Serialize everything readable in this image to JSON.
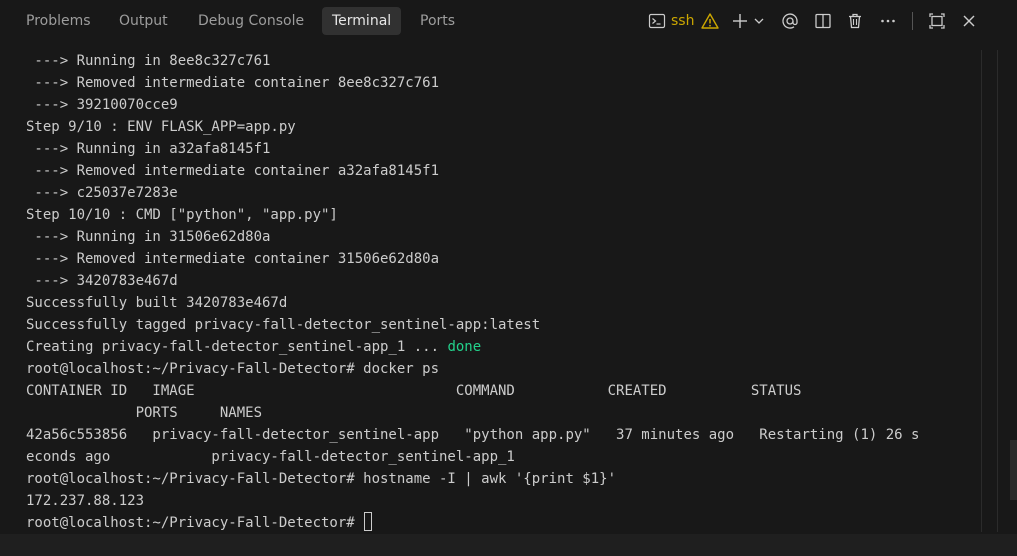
{
  "tabs": [
    {
      "label": "Problems"
    },
    {
      "label": "Output"
    },
    {
      "label": "Debug Console"
    },
    {
      "label": "Terminal",
      "active": true
    },
    {
      "label": "Ports"
    }
  ],
  "actions": {
    "terminal_name": "ssh",
    "icons": [
      "terminal-icon",
      "warning-icon",
      "new-terminal-icon",
      "dropdown-chevron-icon",
      "mention-icon",
      "split-terminal-icon",
      "kill-terminal-icon",
      "more-actions-icon",
      "maximize-panel-icon",
      "close-panel-icon"
    ]
  },
  "colors": {
    "background": "#181818",
    "active_tab": "#313131",
    "warning": "#cca700",
    "done_green": "#23d18b",
    "text": "#cccccc"
  },
  "terminal": {
    "lines": [
      " ---> Running in 8ee8c327c761",
      " ---> Removed intermediate container 8ee8c327c761",
      " ---> 39210070cce9",
      "Step 9/10 : ENV FLASK_APP=app.py",
      " ---> Running in a32afa8145f1",
      " ---> Removed intermediate container a32afa8145f1",
      " ---> c25037e7283e",
      "Step 10/10 : CMD [\"python\", \"app.py\"]",
      " ---> Running in 31506e62d80a",
      " ---> Removed intermediate container 31506e62d80a",
      " ---> 3420783e467d",
      "Successfully built 3420783e467d",
      "Successfully tagged privacy-fall-detector_sentinel-app:latest"
    ],
    "creating_prefix": "Creating privacy-fall-detector_sentinel-app_1 ... ",
    "creating_status": "done",
    "lines2": [
      "root@localhost:~/Privacy-Fall-Detector# docker ps",
      "CONTAINER ID   IMAGE                               COMMAND           CREATED          STATUS",
      "             PORTS     NAMES",
      "42a56c553856   privacy-fall-detector_sentinel-app   \"python app.py\"   37 minutes ago   Restarting (1) 26 s",
      "econds ago            privacy-fall-detector_sentinel-app_1",
      "root@localhost:~/Privacy-Fall-Detector# hostname -I | awk '{print $1}'",
      "172.237.88.123"
    ],
    "prompt": "root@localhost:~/Privacy-Fall-Detector# "
  }
}
